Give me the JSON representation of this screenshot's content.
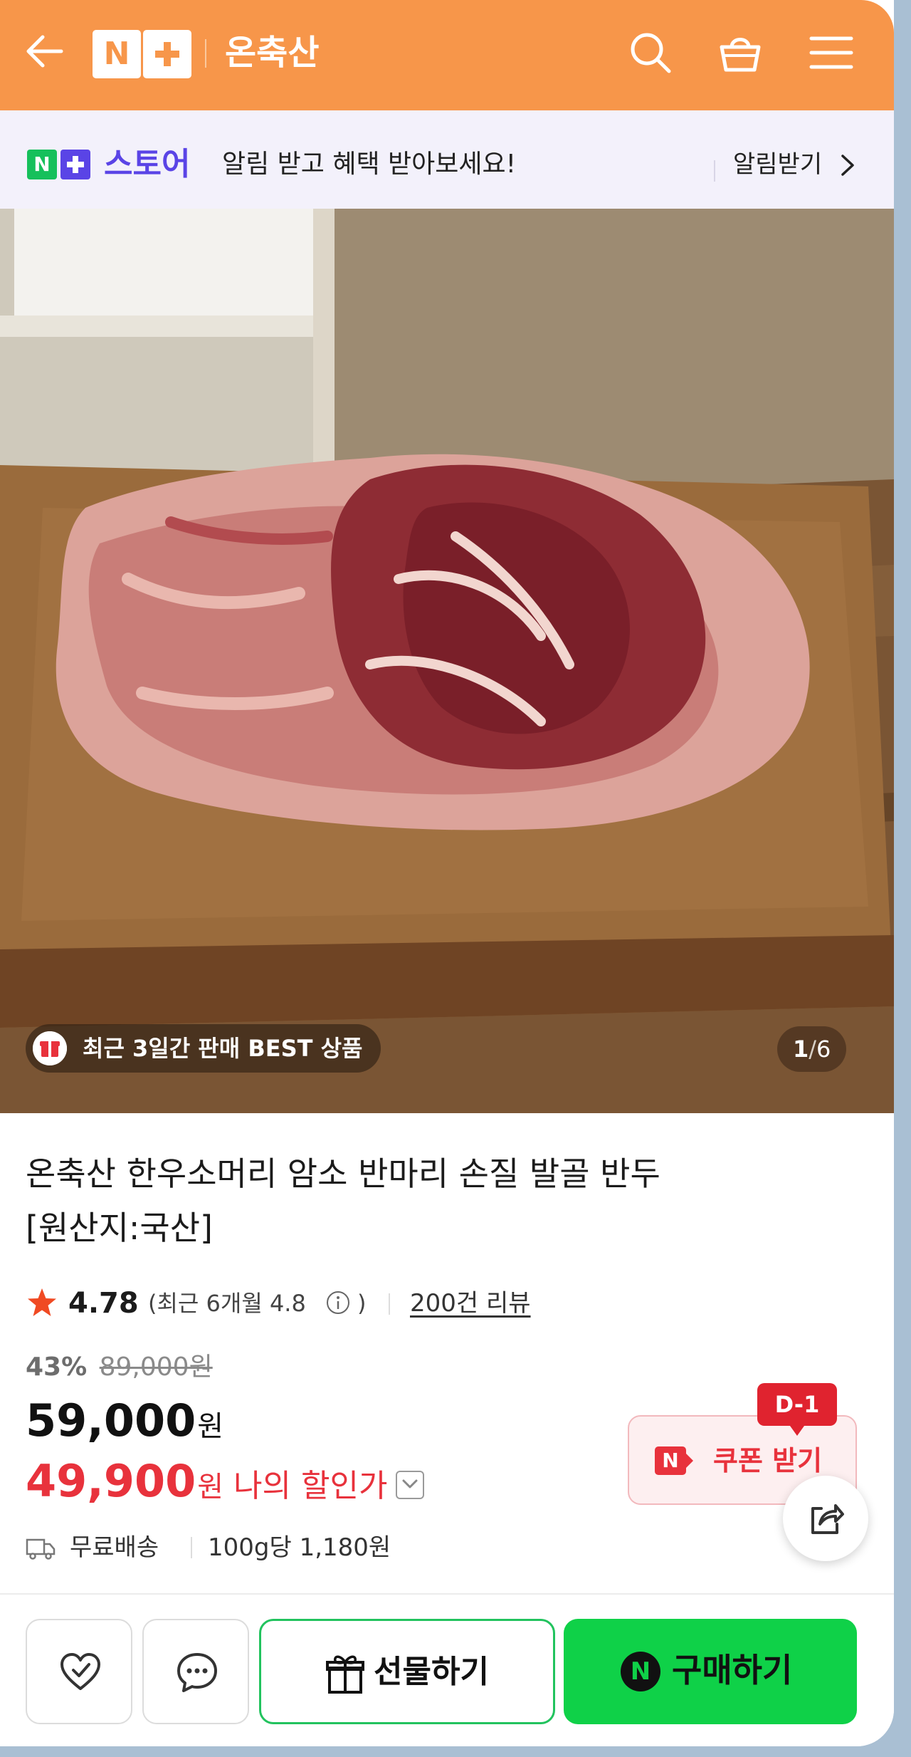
{
  "header": {
    "logo_n": "N",
    "shop_name": "온축산",
    "icons": [
      "back-arrow-icon",
      "search-icon",
      "shopping-basket-icon",
      "hamburger-menu-icon"
    ],
    "accent_color": "#f7964a"
  },
  "notice": {
    "badge_n": "N",
    "store_label": "스토어",
    "message": "알림 받고 혜택 받아보세요!",
    "cta": "알림받기",
    "store_color": "#5a44e6"
  },
  "gallery": {
    "best_badge": "최근 3일간 판매 BEST 상품",
    "current": "1",
    "separator": "/",
    "total": "6"
  },
  "product": {
    "title_line1": "온축산 한우소머리 암소 반마리 손질 발골 반두",
    "title_line2": "[원산지:국산]",
    "rating_score": "4.78",
    "rating_recent": "(최근 6개월 4.8",
    "rating_recent_close": ")",
    "review_count": "200건 리뷰",
    "discount_percent": "43%",
    "original_price": "89,000원",
    "sale_price": "59,000",
    "sale_price_unit": "원",
    "my_price": "49,900",
    "my_price_unit": "원",
    "my_price_label": "나의 할인가",
    "shipping": "무료배송",
    "unit_price": "100g당 1,180원",
    "price_accent_color": "#e8323c"
  },
  "coupon": {
    "dday": "D-1",
    "logo": "N",
    "label": "쿠폰 받기"
  },
  "bottom_bar": {
    "gift_label": "선물하기",
    "buy_logo": "N",
    "buy_label": "구매하기",
    "buy_color": "#0fd148"
  }
}
